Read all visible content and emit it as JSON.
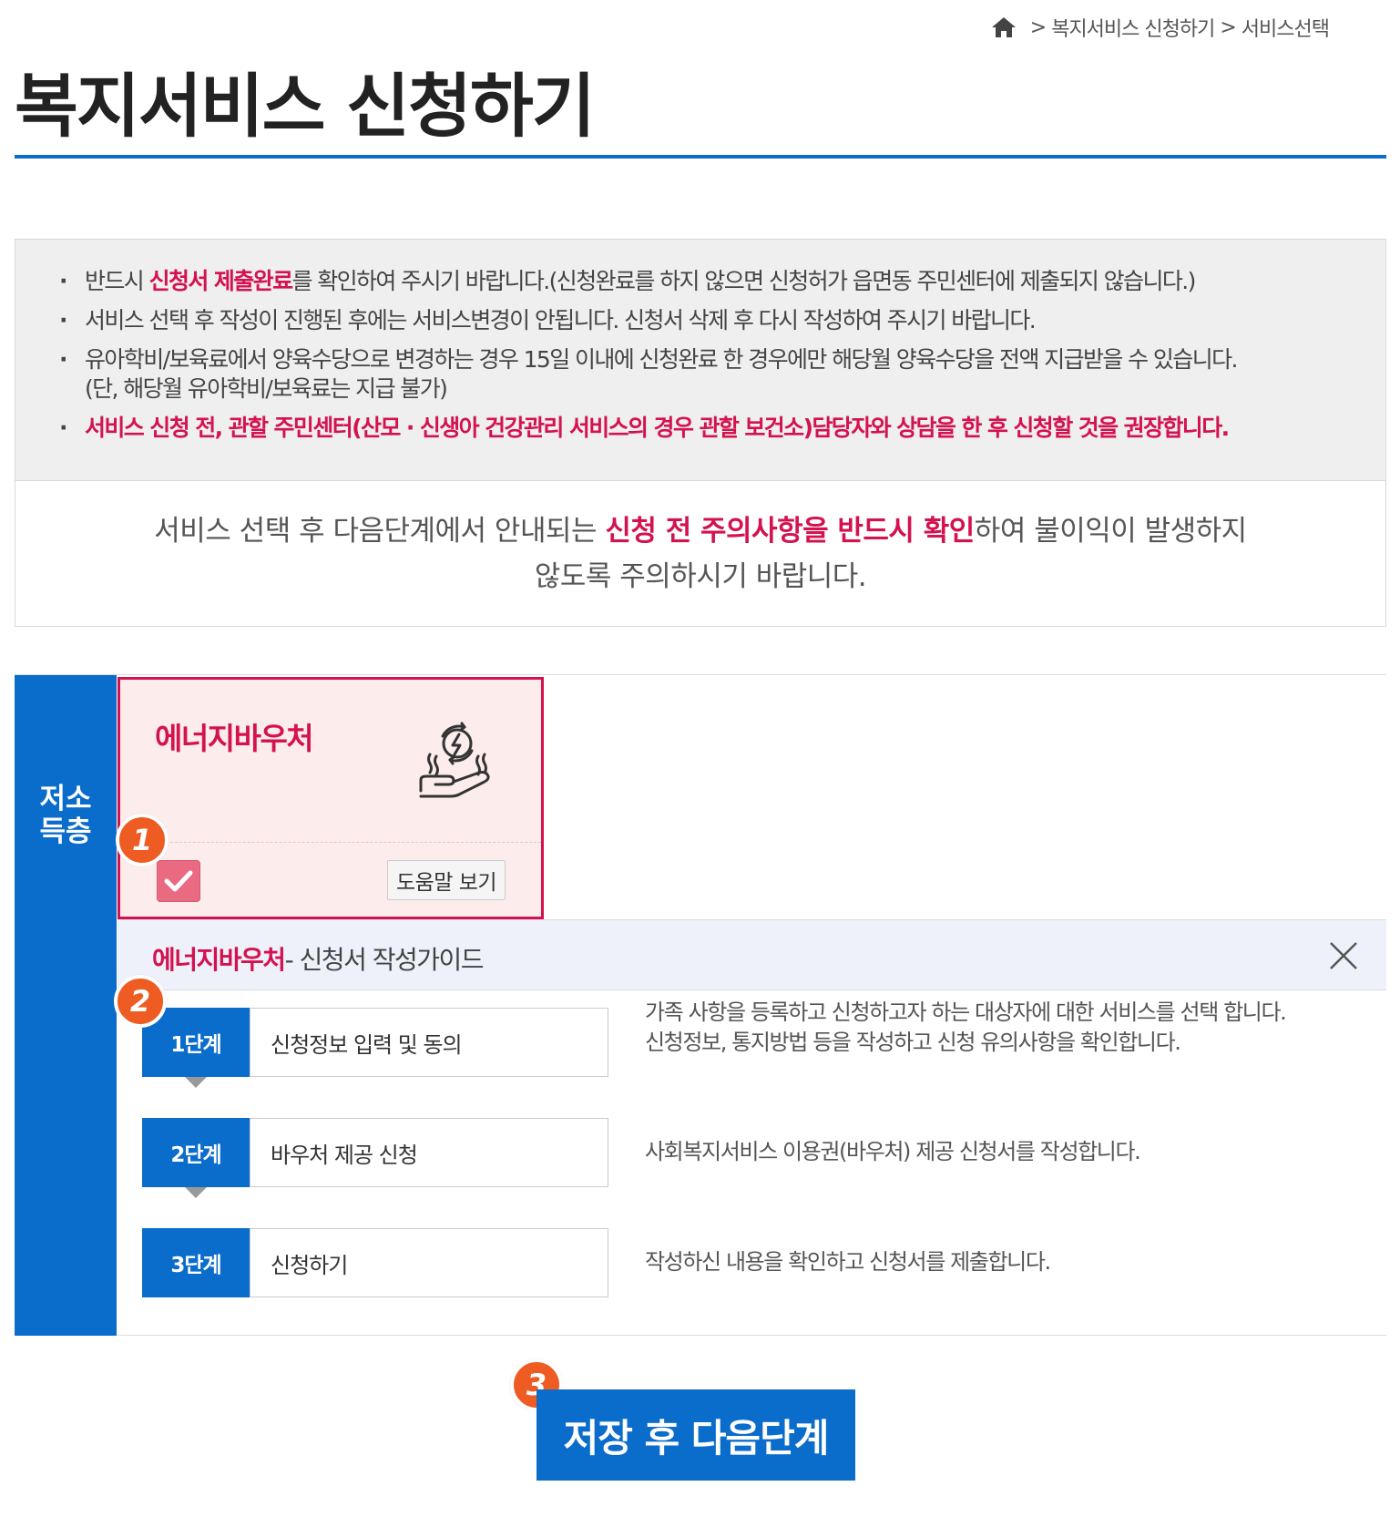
{
  "breadcrumb": {
    "items": [
      "복지서비스 신청하기",
      "서비스선택"
    ],
    "separator": ">"
  },
  "page_title": "복지서비스 신청하기",
  "notice": {
    "items": [
      {
        "pre": "반드시 ",
        "highlight": "신청서 제출완료",
        "post": "를 확인하여 주시기 바랍니다.(신청완료를 하지 않으면 신청허가 읍면동 주민센터에 제출되지 않습니다.)"
      },
      {
        "text": "서비스 선택 후 작성이 진행된 후에는 서비스변경이 안됩니다. 신청서 삭제 후 다시 작성하여 주시기 바랍니다."
      },
      {
        "line1": "유아학비/보육료에서 양육수당으로 변경하는 경우 15일 이내에 신청완료 한 경우에만 해당월 양육수당을 전액 지급받을 수 있습니다.",
        "line2": "(단, 해당월 유아학비/보육료는 지급 불가)"
      },
      {
        "text": "서비스 신청 전, 관할 주민센터(산모 · 신생아 건강관리 서비스의 경우 관할 보건소)담당자와 상담을 한 후 신청할 것을 권장합니다."
      }
    ],
    "caution": {
      "pre": "서비스 선택 후 다음단계에서 안내되는 ",
      "highlight": "신청 전 주의사항을 반드시 확인",
      "post": "하여 불이익이 발생하지",
      "line2": "않도록 주의하시기 바랍니다."
    }
  },
  "category": {
    "line1": "저소",
    "line2": "득층"
  },
  "service_card": {
    "title": "에너지바우처",
    "icon": "energy-hand-icon",
    "checked": true,
    "help_label": "도움말 보기"
  },
  "badges": [
    "1",
    "2",
    "3"
  ],
  "guide": {
    "service": "에너지바우처",
    "suffix": "- 신청서 작성가이드"
  },
  "steps": [
    {
      "num": "1단계",
      "name": "신청정보 입력 및 동의",
      "desc": [
        "가족 사항을 등록하고 신청하고자 하는 대상자에 대한 서비스를 선택 합니다.",
        "신청정보, 통지방법 등을 작성하고 신청 유의사항을 확인합니다."
      ]
    },
    {
      "num": "2단계",
      "name": "바우처 제공 신청",
      "desc": [
        "사회복지서비스 이용권(바우처) 제공 신청서를 작성합니다."
      ]
    },
    {
      "num": "3단계",
      "name": "신청하기",
      "desc": [
        "작성하신 내용을 확인하고 신청서를 제출합니다."
      ]
    }
  ],
  "next_button": "저장 후 다음단계",
  "colors": {
    "accent_blue": "#0a6ccb",
    "accent_red": "#d3124f",
    "badge_orange": "#ee5b23"
  }
}
